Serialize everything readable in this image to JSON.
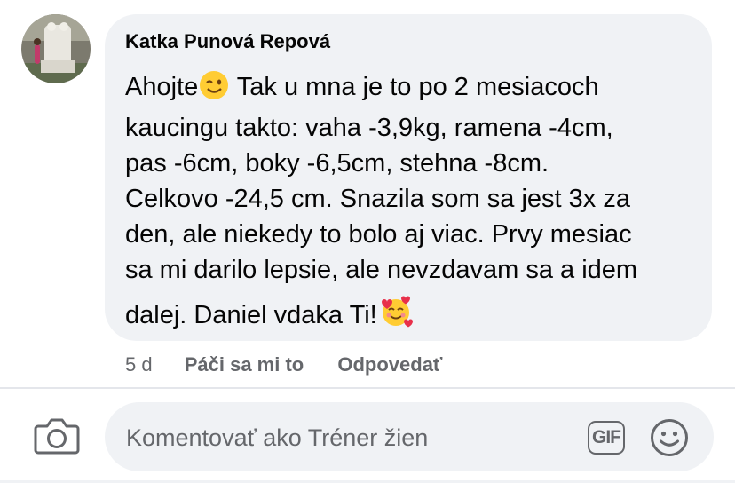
{
  "comment": {
    "author": "Katka Punová Repová",
    "lines": [
      "Ahojte",
      " Tak u mna je to po 2 mesiacoch",
      "kaucingu takto: vaha -3,9kg, ramena -4cm,",
      "pas -6cm, boky -6,5cm, stehna -8cm.",
      "Celkovo -24,5 cm. Snazila som sa jest 3x za",
      "den, ale niekedy to bolo aj viac. Prvy mesiac",
      "sa mi darilo lepsie, ale nevzdavam sa a idem",
      "dalej. Daniel vdaka Ti!"
    ],
    "emoji_1": "winking-face-emoji",
    "emoji_2": "smiling-face-with-hearts-emoji"
  },
  "actions": {
    "time": "5 d",
    "like_label": "Páči sa mi to",
    "reply_label": "Odpovedať"
  },
  "composer": {
    "placeholder": "Komentovať ako Tréner žien",
    "gif_label": "GIF",
    "icons": [
      "camera-icon",
      "gif-icon",
      "emoji-smile-icon"
    ]
  },
  "colors": {
    "bubble": "#f0f2f5",
    "text": "#050505",
    "secondary": "#65676b"
  }
}
